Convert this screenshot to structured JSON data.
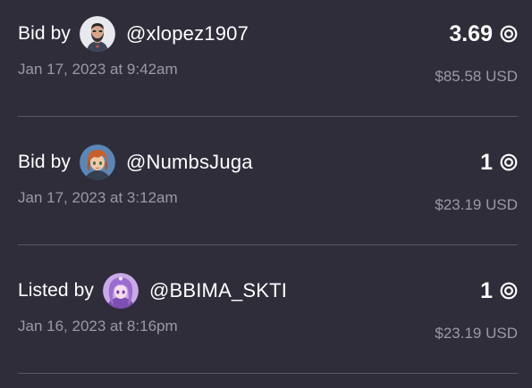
{
  "activity": [
    {
      "action": "Bid by",
      "username": "@xlopez1907",
      "price": "3.69",
      "currency_icon": "coin-icon",
      "timestamp": "Jan 17, 2023 at 9:42am",
      "usd": "$85.58 USD"
    },
    {
      "action": "Bid by",
      "username": "@NumbsJuga",
      "price": "1",
      "currency_icon": "coin-icon",
      "timestamp": "Jan 17, 2023 at 3:12am",
      "usd": "$23.19 USD"
    },
    {
      "action": "Listed by",
      "username": "@BBIMA_SKTI",
      "price": "1",
      "currency_icon": "coin-icon",
      "timestamp": "Jan 16, 2023 at 8:16pm",
      "usd": "$23.19 USD"
    }
  ],
  "colors": {
    "background": "#2f2d3a",
    "divider": "#5a5866",
    "muted_text": "#9b99a6",
    "primary_text": "#ffffff"
  }
}
